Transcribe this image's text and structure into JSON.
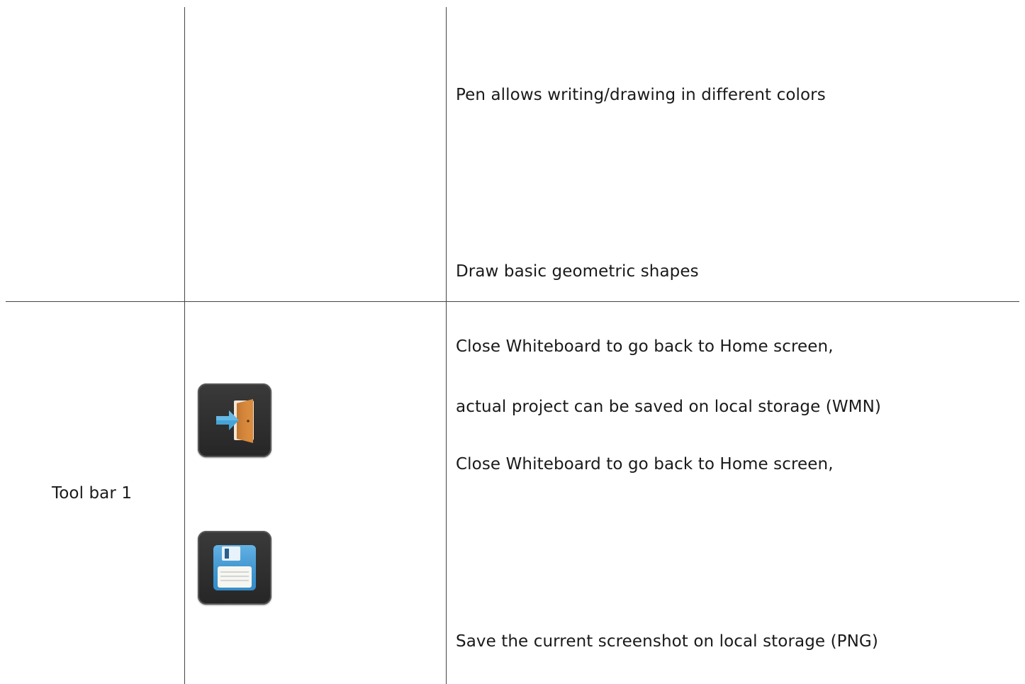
{
  "row_top": {
    "descriptions": [
      "Pen allows writing/drawing in different colors",
      "Draw basic geometric shapes"
    ]
  },
  "row_toolbar1": {
    "label": "Tool bar 1",
    "icons": [
      "exit-door-icon",
      "floppy-disk-save-icon"
    ],
    "descriptions": [
      "Close Whiteboard to go back to Home screen,",
      "actual project can be saved on local storage (WMN)",
      "Close Whiteboard to go back to Home screen,",
      "Save the current screenshot on local storage (PNG)"
    ]
  }
}
